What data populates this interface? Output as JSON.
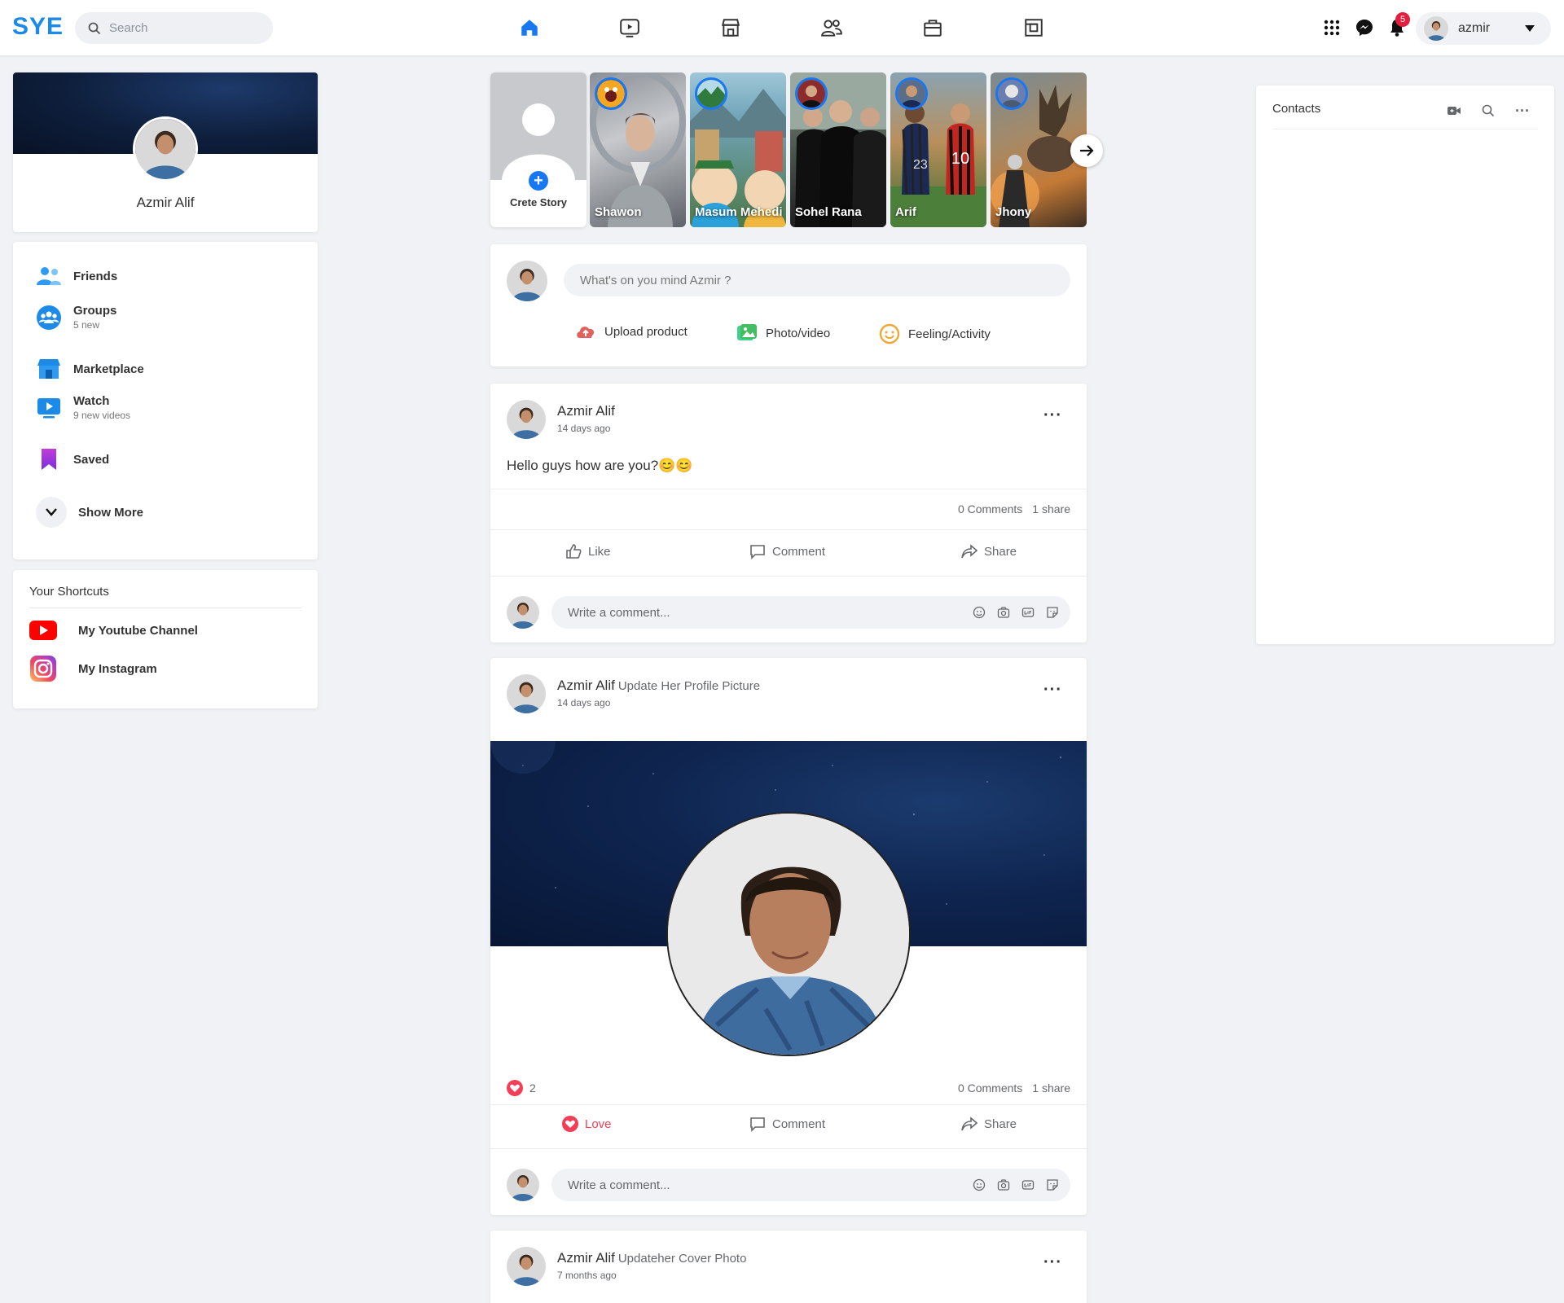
{
  "header": {
    "logo": "SYE",
    "search_placeholder": "Search",
    "notification_count": "5",
    "account_name": "azmir",
    "nav": [
      "home-icon",
      "watch-icon",
      "marketplace-icon",
      "friends-icon",
      "gaming-icon",
      "pages-icon"
    ]
  },
  "profile": {
    "name": "Azmir Alif"
  },
  "menu": {
    "friends": {
      "label": "Friends"
    },
    "groups": {
      "label": "Groups",
      "sub": "5 new"
    },
    "marketplace": {
      "label": "Marketplace"
    },
    "watch": {
      "label": "Watch",
      "sub": "9 new videos"
    },
    "saved": {
      "label": "Saved"
    },
    "show_more": "Show More"
  },
  "shortcuts": {
    "title": "Your Shortcuts",
    "youtube": "My Youtube Channel",
    "instagram": "My Instagram"
  },
  "stories": {
    "create_label": "Crete Story",
    "items": [
      "Shawon",
      "Masum Mehedi",
      "Sohel Rana",
      "Arif",
      "Jhony"
    ]
  },
  "composer": {
    "placeholder": "What's on you mind Azmir ?",
    "upload": "Upload product",
    "photo": "Photo/video",
    "feeling": "Feeling/Activity"
  },
  "posts": [
    {
      "author": "Azmir Alif",
      "action": "",
      "time": "14 days ago",
      "text": "Hello guys how are you?😊😊",
      "comments": "0 Comments",
      "shares": "1 share",
      "like_label": "Like",
      "comment_label": "Comment",
      "share_label": "Share",
      "comment_placeholder": "Write a comment..."
    },
    {
      "author": "Azmir Alif",
      "action": "Update Her Profile Picture",
      "time": "14 days ago",
      "reactions": "2",
      "comments": "0 Comments",
      "shares": "1 share",
      "love_label": "Love",
      "comment_label": "Comment",
      "share_label": "Share",
      "comment_placeholder": "Write a comment..."
    },
    {
      "author": "Azmir Alif",
      "action": "Updateher Cover Photo",
      "time": "7 months ago"
    }
  ],
  "contacts": {
    "title": "Contacts"
  },
  "colors": {
    "brand": "#1b8ae8",
    "notification": "#e41e3f",
    "love": "#f33e58",
    "bg": "#f0f2f5"
  }
}
